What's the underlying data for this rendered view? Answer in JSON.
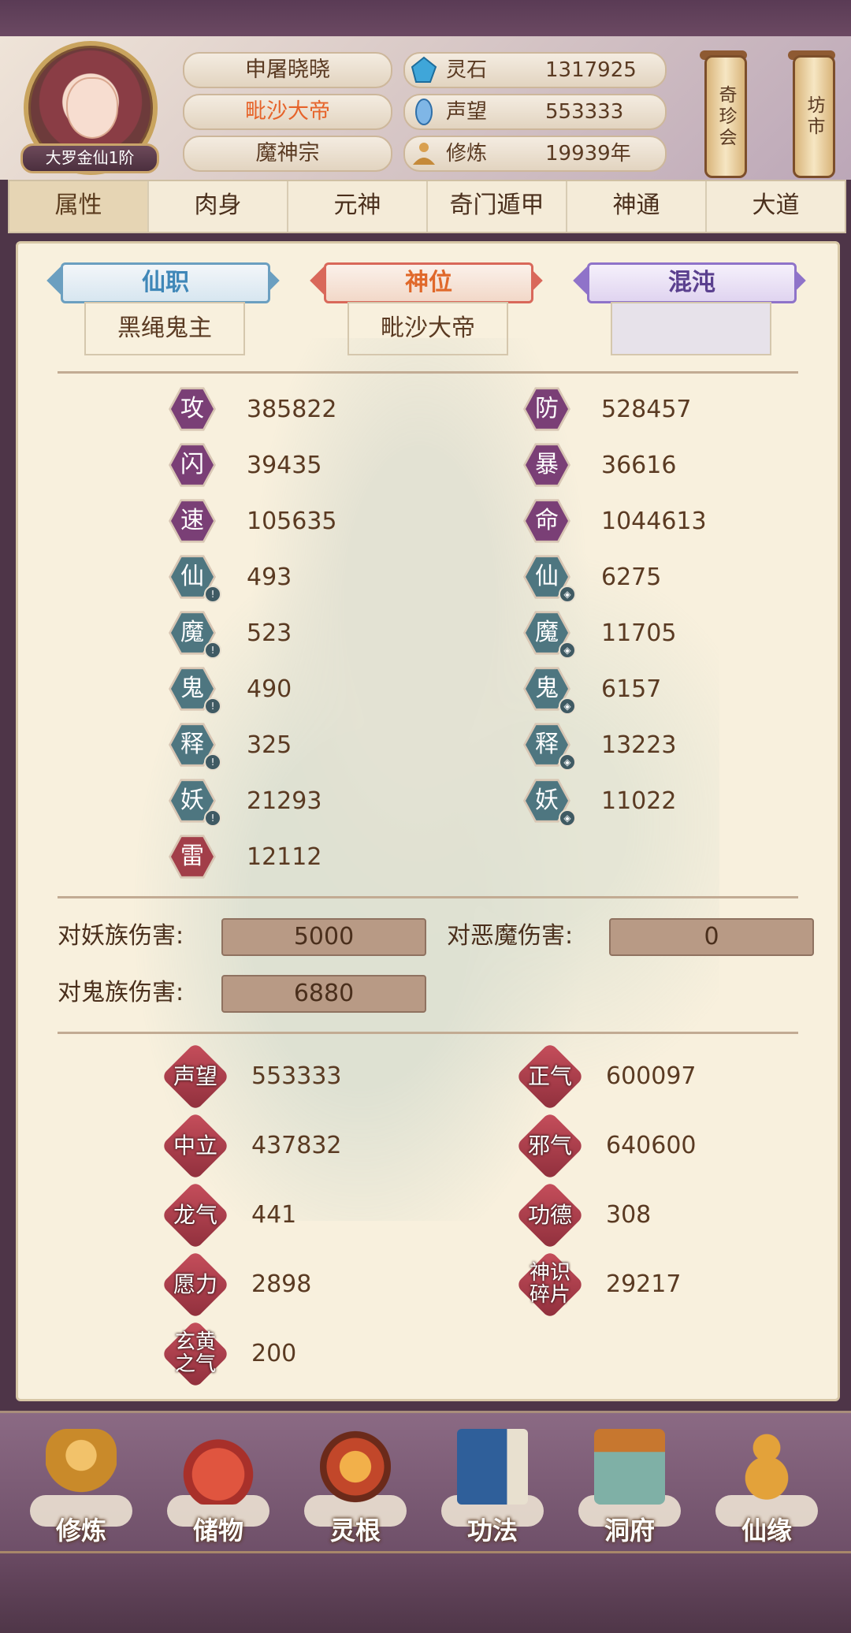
{
  "header": {
    "rank": "大罗金仙1阶",
    "names": [
      "申屠晓晓",
      "毗沙大帝",
      "魔神宗"
    ],
    "resources": [
      {
        "label": "灵石",
        "value": "1317925",
        "icon": "spirit-stone-icon"
      },
      {
        "label": "声望",
        "value": "553333",
        "icon": "prestige-icon"
      },
      {
        "label": "修炼",
        "value": "19939年",
        "icon": "meditation-icon"
      }
    ],
    "buttons": {
      "treasure": "奇珍会",
      "market": "坊市"
    }
  },
  "tabs": [
    "属性",
    "肉身",
    "元神",
    "奇门遁甲",
    "神通",
    "大道"
  ],
  "titles": {
    "xianzhi": {
      "label": "仙职",
      "value": "黑绳鬼主"
    },
    "shenwei": {
      "label": "神位",
      "value": "毗沙大帝"
    },
    "hundun": {
      "label": "混沌",
      "value": ""
    }
  },
  "stats_left": [
    {
      "char": "攻",
      "value": "385822"
    },
    {
      "char": "闪",
      "value": "39435"
    },
    {
      "char": "速",
      "value": "105635"
    },
    {
      "char": "仙",
      "value": "493"
    },
    {
      "char": "魔",
      "value": "523"
    },
    {
      "char": "鬼",
      "value": "490"
    },
    {
      "char": "释",
      "value": "325"
    },
    {
      "char": "妖",
      "value": "21293"
    },
    {
      "char": "雷",
      "value": "12112"
    }
  ],
  "stats_right": [
    {
      "char": "防",
      "value": "528457"
    },
    {
      "char": "暴",
      "value": "36616"
    },
    {
      "char": "命",
      "value": "1044613"
    },
    {
      "char": "仙",
      "value": "6275"
    },
    {
      "char": "魔",
      "value": "11705"
    },
    {
      "char": "鬼",
      "value": "6157"
    },
    {
      "char": "释",
      "value": "13223"
    },
    {
      "char": "妖",
      "value": "11022"
    }
  ],
  "damage": {
    "yao_label": "对妖族伤害:",
    "yao_value": "5000",
    "emo_label": "对恶魔伤害:",
    "emo_value": "0",
    "gui_label": "对鬼族伤害:",
    "gui_value": "6880"
  },
  "reputation_left": [
    {
      "label": "声望",
      "value": "553333"
    },
    {
      "label": "中立",
      "value": "437832"
    },
    {
      "label": "龙气",
      "value": "441"
    },
    {
      "label": "愿力",
      "value": "2898"
    },
    {
      "label": "玄黄之气",
      "value": "200"
    }
  ],
  "reputation_right": [
    {
      "label": "正气",
      "value": "600097"
    },
    {
      "label": "邪气",
      "value": "640600"
    },
    {
      "label": "功德",
      "value": "308"
    },
    {
      "label": "神识碎片",
      "value": "29217"
    }
  ],
  "nav": [
    "修炼",
    "储物",
    "灵根",
    "功法",
    "洞府",
    "仙缘"
  ],
  "colors": {
    "accent_orange": "#e6632a",
    "stat_purple": "#7a3f76",
    "stat_teal": "#4e7680",
    "stat_red": "#a23e49"
  }
}
